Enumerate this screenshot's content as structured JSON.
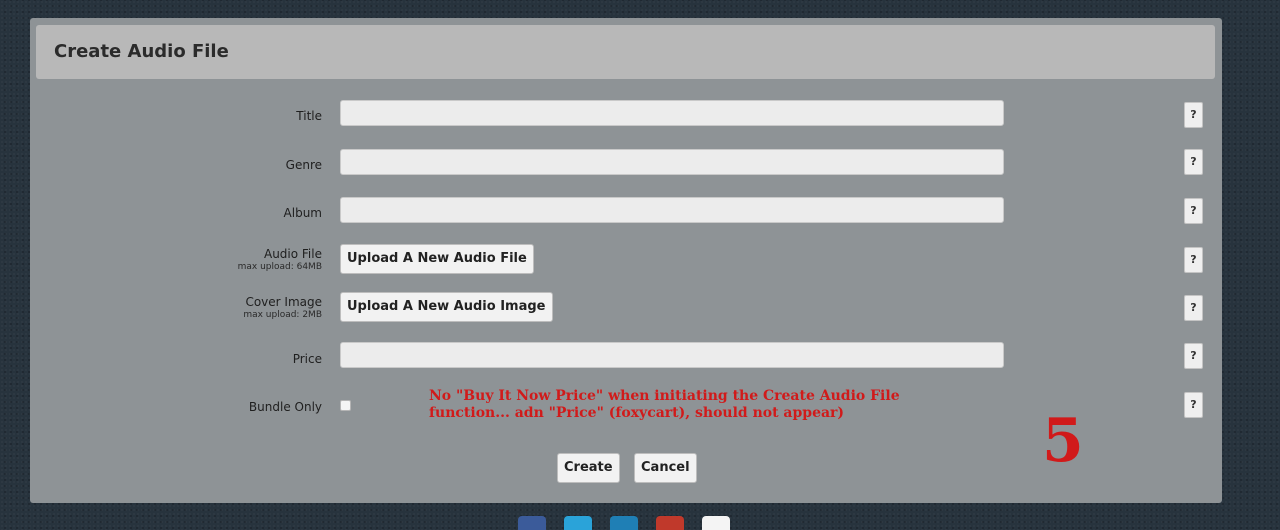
{
  "panel": {
    "title": "Create Audio File"
  },
  "form": {
    "title_label": "Title",
    "title_value": "",
    "genre_label": "Genre",
    "genre_value": "",
    "album_label": "Album",
    "album_value": "",
    "audio_file_label": "Audio File",
    "audio_file_hint": "max upload: 64MB",
    "audio_file_button": "Upload A New Audio File",
    "cover_image_label": "Cover Image",
    "cover_image_hint": "max upload: 2MB",
    "cover_image_button": "Upload A New Audio Image",
    "price_label": "Price",
    "price_value": "",
    "bundle_only_label": "Bundle Only",
    "bundle_only_checked": false,
    "help_label": "?"
  },
  "actions": {
    "create": "Create",
    "cancel": "Cancel"
  },
  "annotation": {
    "note_line1": "No \"Buy It Now Price\" when initiating the Create Audio File",
    "note_line2": "function... adn \"Price\" (foxycart), should not appear)",
    "number": "5",
    "color": "#d11a1a"
  },
  "footer": {
    "icons": [
      {
        "name": "social-icon-1",
        "color": "#3b5b9a"
      },
      {
        "name": "social-icon-2",
        "color": "#2aa3d9"
      },
      {
        "name": "social-icon-3",
        "color": "#1f7fb5"
      },
      {
        "name": "social-icon-4",
        "color": "#c0392b"
      },
      {
        "name": "social-icon-5",
        "color": "#f4f4f4"
      }
    ]
  }
}
